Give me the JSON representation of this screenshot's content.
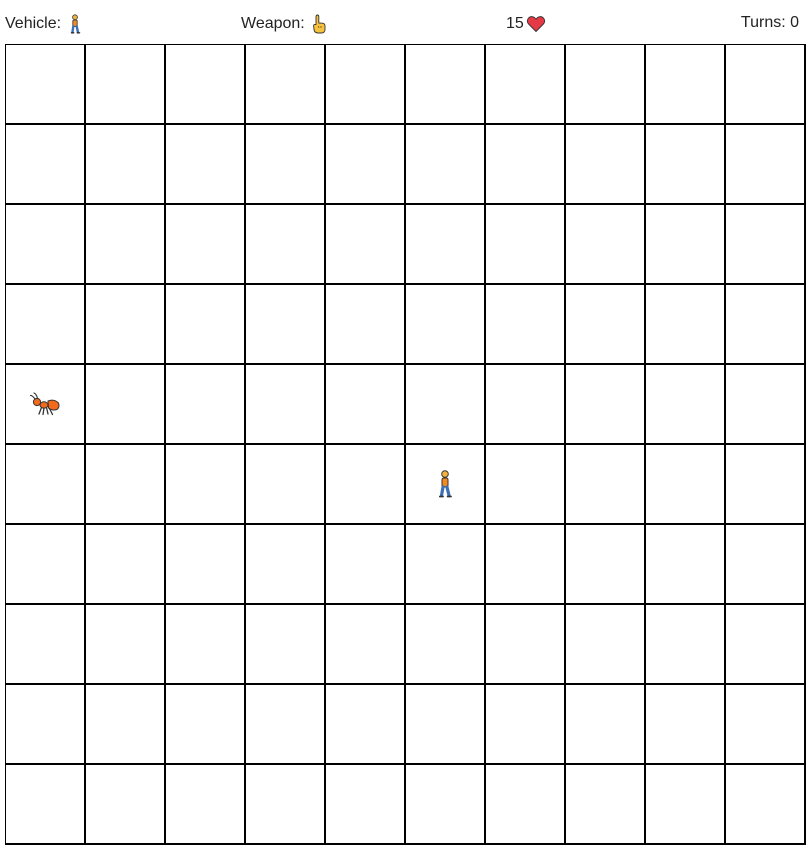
{
  "hud": {
    "vehicle_label": "Vehicle:",
    "vehicle_icon": "walking-person-icon",
    "weapon_label": "Weapon:",
    "weapon_icon": "pointing-hand-icon",
    "health_value": "15",
    "health_icon": "heart-icon",
    "turns_text": "Turns: 0"
  },
  "board": {
    "rows": 10,
    "cols": 10,
    "pieces": [
      {
        "name": "enemy-ant",
        "icon": "ant-icon",
        "row": 4,
        "col": 0
      },
      {
        "name": "player",
        "icon": "walking-person-icon",
        "row": 5,
        "col": 5
      }
    ]
  },
  "colors": {
    "grid_line": "#000000",
    "cell_background": "#ffffff",
    "heart": "#e63946",
    "ant": "#f26a1b",
    "person_shirt": "#f28b20",
    "person_pants": "#3d6fb6",
    "hand": "#f7c23c"
  }
}
